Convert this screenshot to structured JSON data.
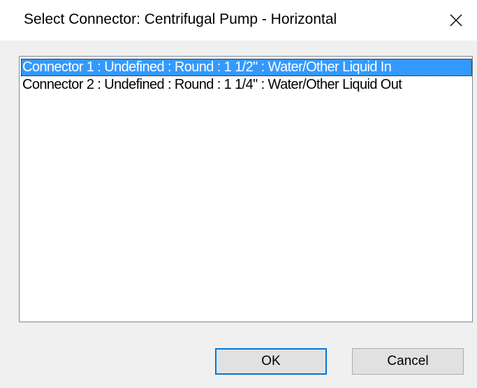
{
  "window": {
    "title": "Select Connector: Centrifugal Pump - Horizontal",
    "close_icon": "close-icon"
  },
  "connector_list": {
    "items": [
      {
        "label": "Connector 1 : Undefined : Round : 1 1/2\" : Water/Other Liquid In",
        "selected": true
      },
      {
        "label": "Connector 2 : Undefined : Round : 1 1/4\" : Water/Other Liquid Out",
        "selected": false
      }
    ]
  },
  "buttons": {
    "ok_label": "OK",
    "cancel_label": "Cancel"
  },
  "colors": {
    "selection": "#3399ff",
    "default_button_border": "#0078d7",
    "dialog_background": "#f0f0f0"
  }
}
